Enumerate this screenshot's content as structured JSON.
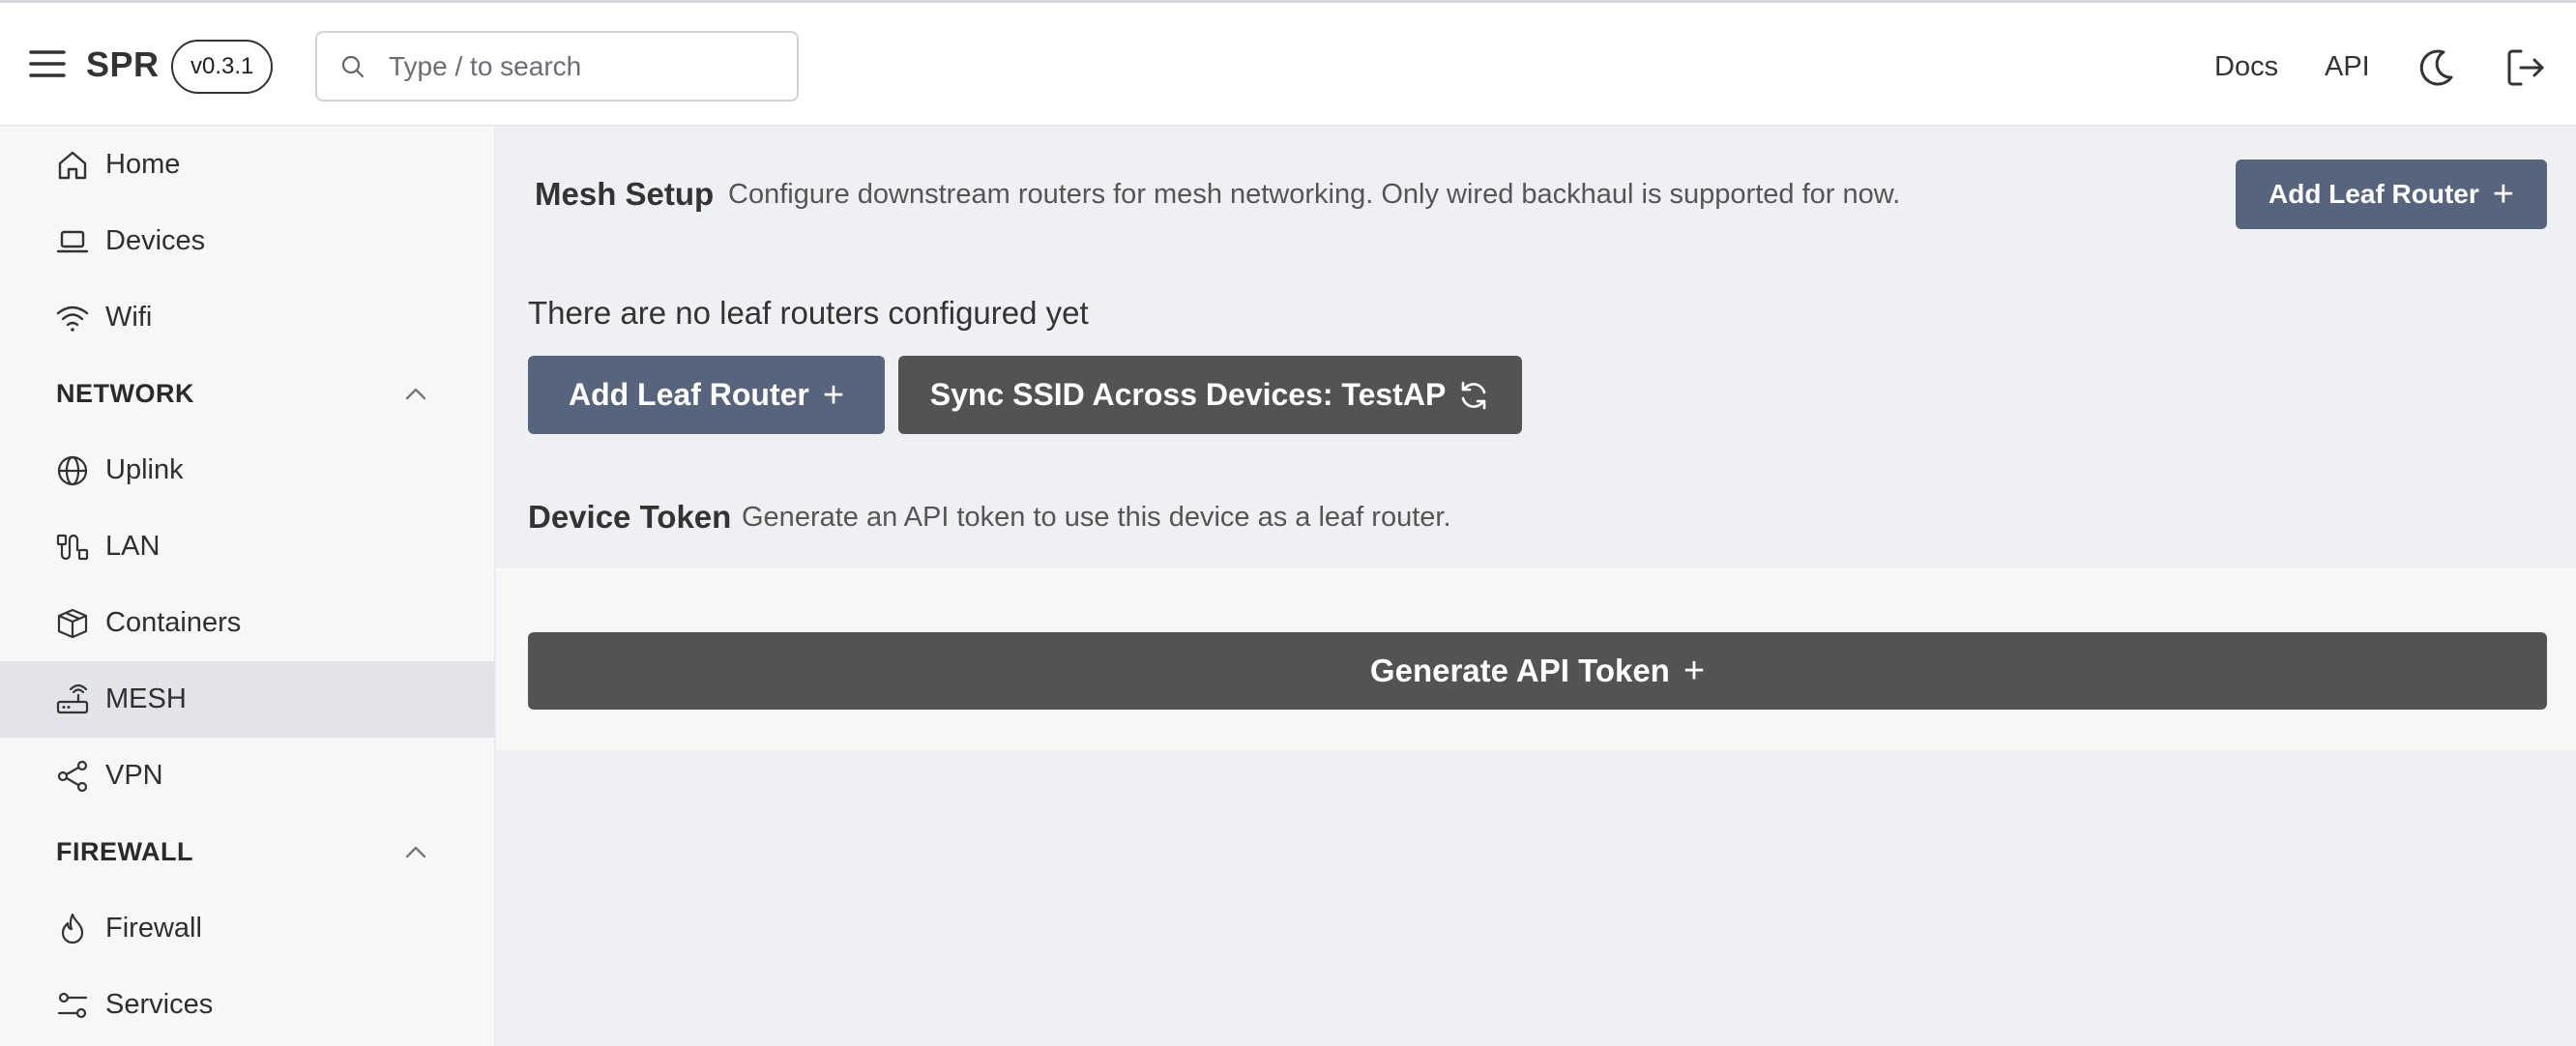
{
  "header": {
    "brand": "SPR",
    "version": "v0.3.1",
    "search_placeholder": "Type / to search",
    "docs_label": "Docs",
    "api_label": "API",
    "icons": [
      "menu-icon",
      "search-icon",
      "moon-icon",
      "logout-icon"
    ]
  },
  "sidebar": {
    "items": [
      {
        "label": "Home",
        "icon": "home-icon"
      },
      {
        "label": "Devices",
        "icon": "laptop-icon"
      },
      {
        "label": "Wifi",
        "icon": "wifi-icon"
      }
    ],
    "network": {
      "heading": "NETWORK",
      "items": [
        {
          "label": "Uplink",
          "icon": "globe-icon"
        },
        {
          "label": "LAN",
          "icon": "cable-icon"
        },
        {
          "label": "Containers",
          "icon": "box-icon"
        },
        {
          "label": "MESH",
          "icon": "router-icon",
          "active": true
        },
        {
          "label": "VPN",
          "icon": "network-nodes-icon"
        }
      ]
    },
    "firewall": {
      "heading": "FIREWALL",
      "items": [
        {
          "label": "Firewall",
          "icon": "flame-icon"
        },
        {
          "label": "Services",
          "icon": "sliders-icon"
        }
      ]
    }
  },
  "main": {
    "mesh_title": "Mesh Setup",
    "mesh_description": "Configure downstream routers for mesh networking. Only wired backhaul is supported for now.",
    "top_add_label": "Add Leaf Router",
    "empty_message": "There are no leaf routers configured yet",
    "add_label": "Add Leaf Router",
    "sync_label": "Sync SSID Across Devices: TestAP",
    "token_title": "Device Token",
    "token_description": "Generate an API token to use this device as a leaf router.",
    "generate_label": "Generate API Token",
    "plus_glyph": "+"
  },
  "colors": {
    "primary_button": "#56657d",
    "dark_button": "#535353",
    "background": "#eff0f4",
    "sidebar_background": "#f7f7f7",
    "active_item": "#e3e4e9"
  }
}
